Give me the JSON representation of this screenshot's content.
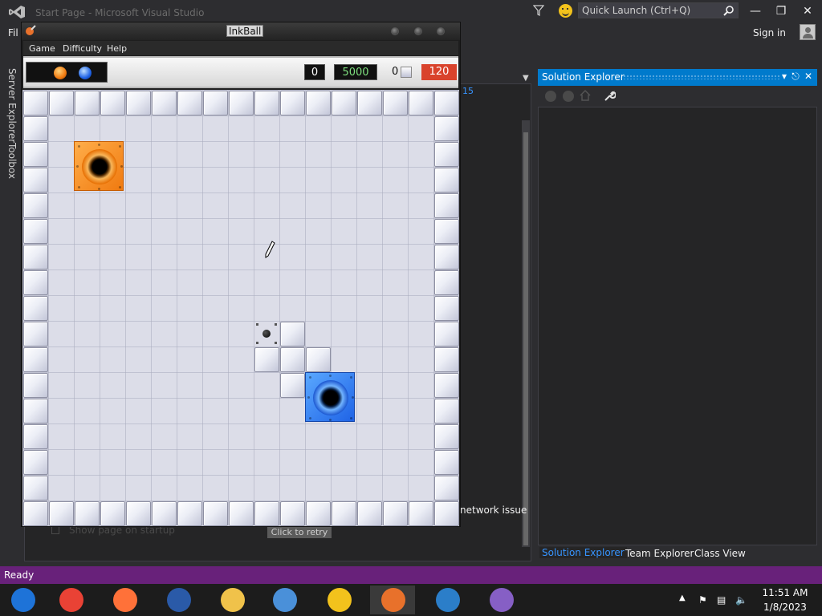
{
  "vs": {
    "title": "Start Page - Microsoft Visual Studio",
    "quick_launch_placeholder": "Quick Launch (Ctrl+Q)",
    "menu_file_partial": "Fil",
    "sign_in": "Sign in",
    "server_explorer": "Server Explorer",
    "toolbox": "Toolbox",
    "doc_number_fragment": "15",
    "network_issue_fragment": "network issue",
    "retry_button": "Click to retry",
    "show_page_on_startup": "Show page on startup",
    "status": "Ready"
  },
  "solution_explorer": {
    "title": "Solution Explorer",
    "tabs": [
      {
        "label": "Solution Explorer",
        "active": true
      },
      {
        "label": "Team Explorer",
        "active": false
      },
      {
        "label": "Class View",
        "active": false
      }
    ]
  },
  "taskbar": {
    "apps": [
      {
        "name": "chromium-icon",
        "color": "#1e73d8"
      },
      {
        "name": "chrome-icon",
        "color": "#e94235"
      },
      {
        "name": "firefox-icon",
        "color": "#ff7139"
      },
      {
        "name": "obama-logo-icon",
        "color": "#2a5aa8"
      },
      {
        "name": "file-explorer-icon",
        "color": "#f0c24a"
      },
      {
        "name": "network-people-icon",
        "color": "#4a90d9"
      },
      {
        "name": "smiley-face-icon",
        "color": "#f2c21c"
      },
      {
        "name": "inkball-icon",
        "color": "#e8712b"
      },
      {
        "name": "help-icon",
        "color": "#2b7ec9"
      },
      {
        "name": "visual-studio-icon",
        "color": "#865fc5"
      }
    ],
    "time": "11:51 AM",
    "date": "1/8/2023"
  },
  "inkball": {
    "title": "InkBall",
    "menu": [
      "Game",
      "Difficulty",
      "Help"
    ],
    "score": "0",
    "goal": "5000",
    "blocks_count": "0",
    "timer": "120",
    "tray_balls": [
      "orange",
      "blue"
    ],
    "colors": {
      "orange": "#f07a10",
      "blue": "#1f63e6",
      "timer": "#d9432c",
      "accent": "#007acc"
    }
  }
}
